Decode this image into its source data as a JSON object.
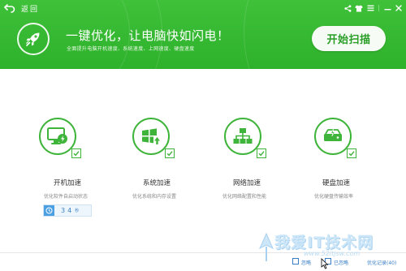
{
  "header": {
    "back_label": "返回",
    "banner_title": "一键优化，让电脑快如闪电！",
    "banner_subtitle": "全面提升电脑开机速度、系统速度、上网速度、硬盘速度",
    "scan_button": "开始扫描",
    "accent": "#2eb12b"
  },
  "items": [
    {
      "title": "开机加速",
      "desc": "优化软件自启动状态",
      "icon": "monitor-lightning-icon"
    },
    {
      "title": "系统加速",
      "desc": "优化系统和内存设置",
      "icon": "windows-up-icon"
    },
    {
      "title": "网络加速",
      "desc": "优化网络配置和性能",
      "icon": "network-icon"
    },
    {
      "title": "硬盘加速",
      "desc": "优化硬盘传输效率",
      "icon": "harddisk-lightning-icon"
    }
  ],
  "timer": {
    "value": "34",
    "unit": "秒"
  },
  "footer": {
    "ignore_label": "忽略",
    "done_label": "已忽略",
    "record_label": "优化记录(40)"
  },
  "watermark": {
    "text": "我爱IT技术网",
    "url": "www.52itjsw.com"
  }
}
